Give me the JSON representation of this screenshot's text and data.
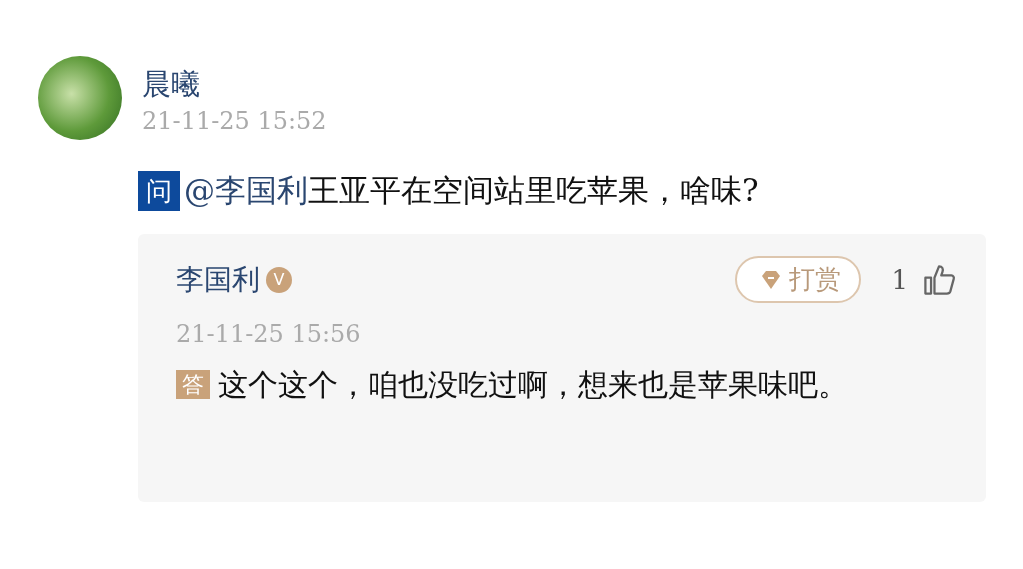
{
  "question": {
    "author": "晨曦",
    "time": "21-11-25 15:52",
    "badge": "问",
    "mention": "@李国利",
    "text": "王亚平在空间站里吃苹果，啥味?"
  },
  "answer": {
    "author": "李国利",
    "verified": true,
    "verified_mark": "V",
    "reward_label": "打赏",
    "likes": "1",
    "time": "21-11-25 15:56",
    "badge": "答",
    "text": "这个这个，咱也没吃过啊，想来也是苹果味吧。"
  }
}
